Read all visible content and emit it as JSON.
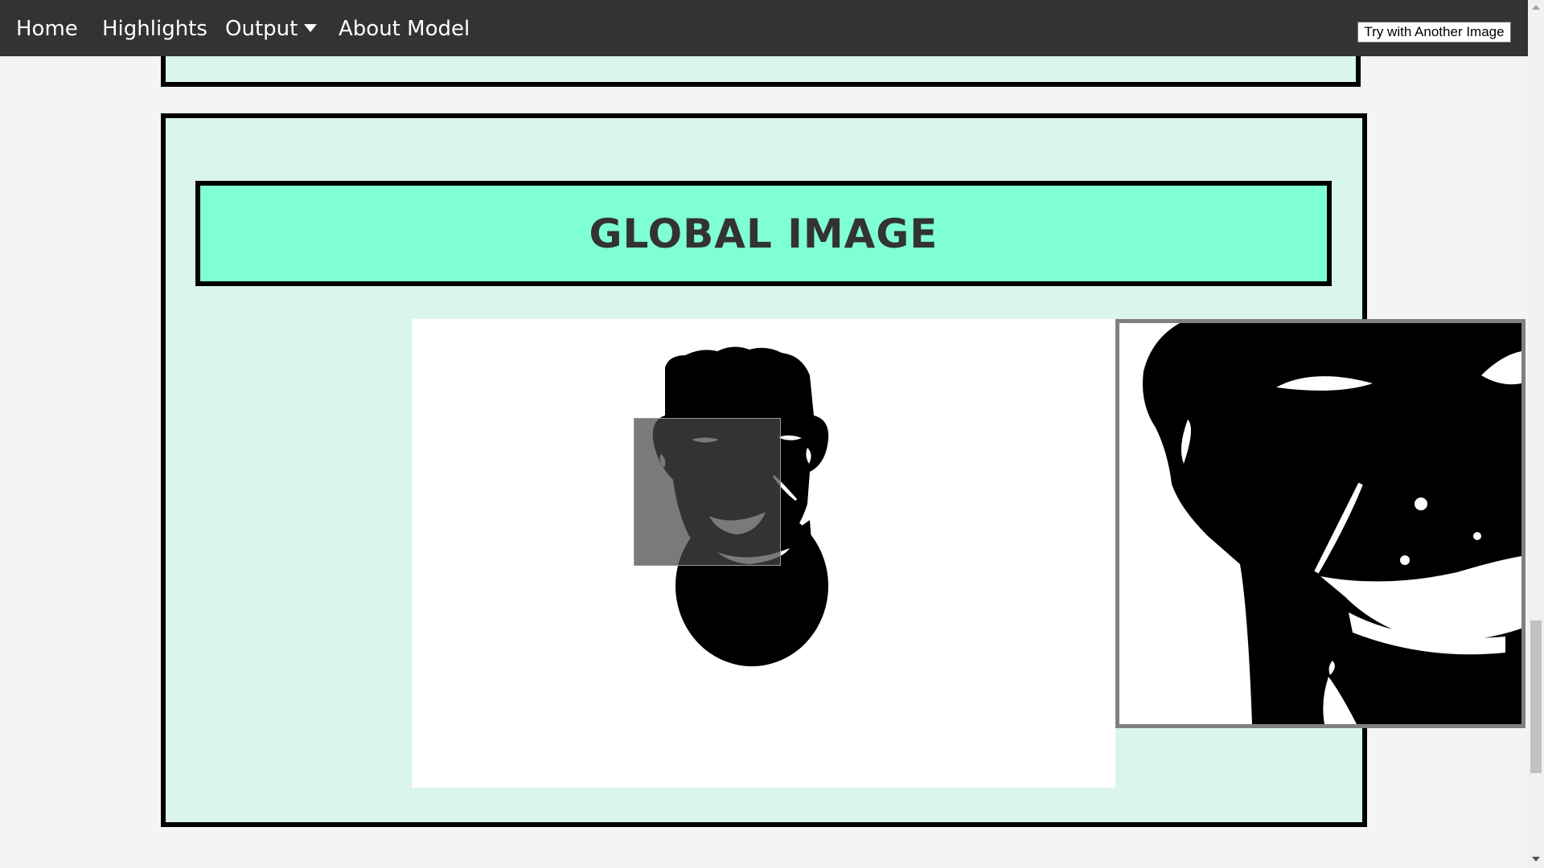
{
  "nav": {
    "home": "Home",
    "highlights": "Highlights",
    "output": "Output",
    "about": "About Model",
    "try_button": "Try with Another Image"
  },
  "section": {
    "title": "GLOBAL IMAGE"
  },
  "colors": {
    "navbar": "#333333",
    "section_bg": "#d9f5ec",
    "heading_bg": "#7fffd4",
    "heading_text": "#333333"
  },
  "icons": {
    "output_dropdown": "caret-down-icon"
  }
}
